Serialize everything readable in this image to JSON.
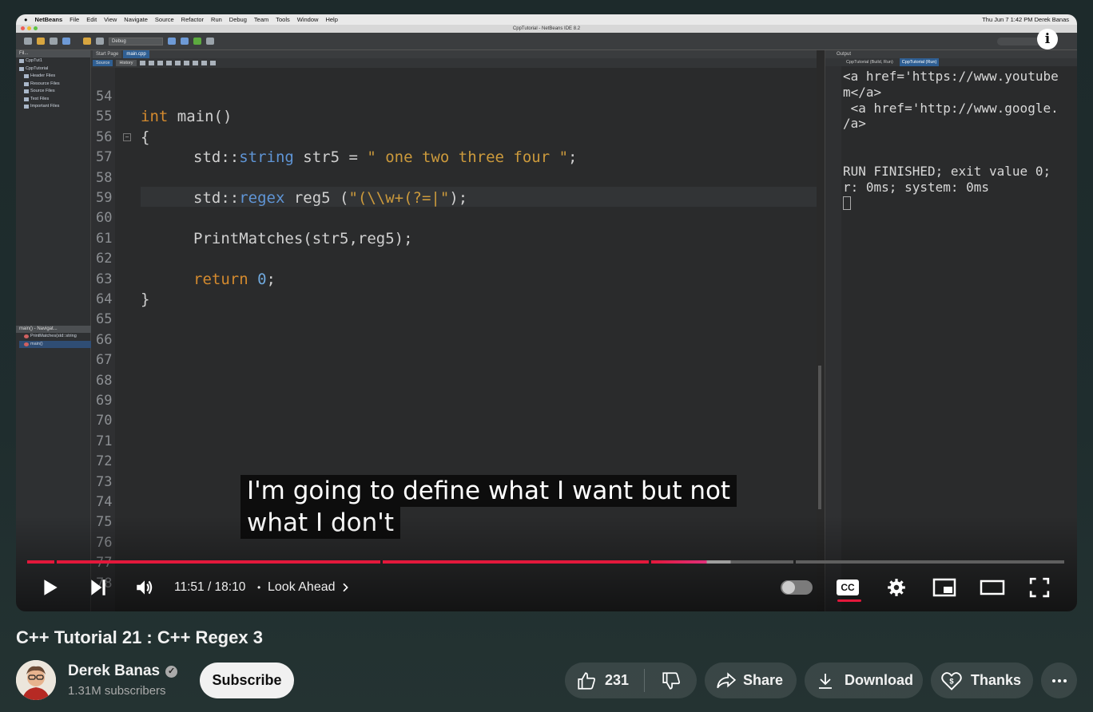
{
  "ide": {
    "menu": [
      "NetBeans",
      "File",
      "Edit",
      "View",
      "Navigate",
      "Source",
      "Refactor",
      "Run",
      "Debug",
      "Team",
      "Tools",
      "Window",
      "Help"
    ],
    "menu_right": "Thu Jun 7  1:42 PM   Derek Banas",
    "window_title": "CppTutorial - NetBeans IDE 8.2",
    "config": "Debug",
    "projects_tab": "Fil...",
    "projects": [
      "CppTut1",
      "CppTutorial",
      "Header Files",
      "Resource Files",
      "Source Files",
      "Test Files",
      "Important Files"
    ],
    "navigator_tab": "main() - Navigat...",
    "navigator": [
      "PrintMatches(std::string",
      "main()"
    ],
    "editor_tabs": [
      "Start Page",
      "main.cpp"
    ],
    "editor_subtabs": [
      "Source",
      "History"
    ],
    "line_numbers": [
      "54",
      "55",
      "56",
      "57",
      "58",
      "59",
      "60",
      "61",
      "62",
      "63",
      "64",
      "65",
      "66",
      "67",
      "68",
      "69",
      "70",
      "71",
      "72",
      "73",
      "74",
      "75",
      "76",
      "77",
      "78"
    ],
    "code": {
      "l55_kw": "int",
      "l55_rest": " main()",
      "l56": "{",
      "l57_a": "std::",
      "l57_type": "string",
      "l57_b": " str5 = ",
      "l57_str": "\" one two three four \"",
      "l57_c": ";",
      "l59_a": "std::",
      "l59_type": "regex",
      "l59_b": " reg5 (",
      "l59_str": "\"(\\\\w+(?=|\"",
      "l59_c": ");",
      "l61": "PrintMatches(str5,reg5);",
      "l63_kw": "return",
      "l63_num": " 0",
      "l63_c": ";",
      "l64": "}"
    },
    "output_tab": "Output",
    "output_subtabs": [
      "CppTutorial (Build, Run)",
      "CppTutorial (Run)"
    ],
    "output_lines": [
      "<a href='https://www.youtube",
      "m</a>",
      " <a href='http://www.google.",
      "/a>",
      "",
      "",
      "RUN FINISHED; exit value 0;",
      "r: 0ms; system: 0ms"
    ]
  },
  "caption": {
    "line1": "I'm going to define what I want but not",
    "line2": "what I don't"
  },
  "player": {
    "time": "11:51 / 18:10",
    "separator": "•",
    "chapter": "Look Ahead",
    "progress": 0.652,
    "info_icon": "i",
    "cc_label": "CC",
    "colors": {
      "played": "#e3183b",
      "buffered": "#9e9e9e",
      "unplayed": "#5f5f5f"
    }
  },
  "video": {
    "title": "C++ Tutorial 21 : C++ Regex 3",
    "channel": "Derek Banas",
    "subscribers": "1.31M subscribers",
    "subscribe_label": "Subscribe",
    "likes": "231",
    "share_label": "Share",
    "download_label": "Download",
    "thanks_label": "Thanks"
  }
}
